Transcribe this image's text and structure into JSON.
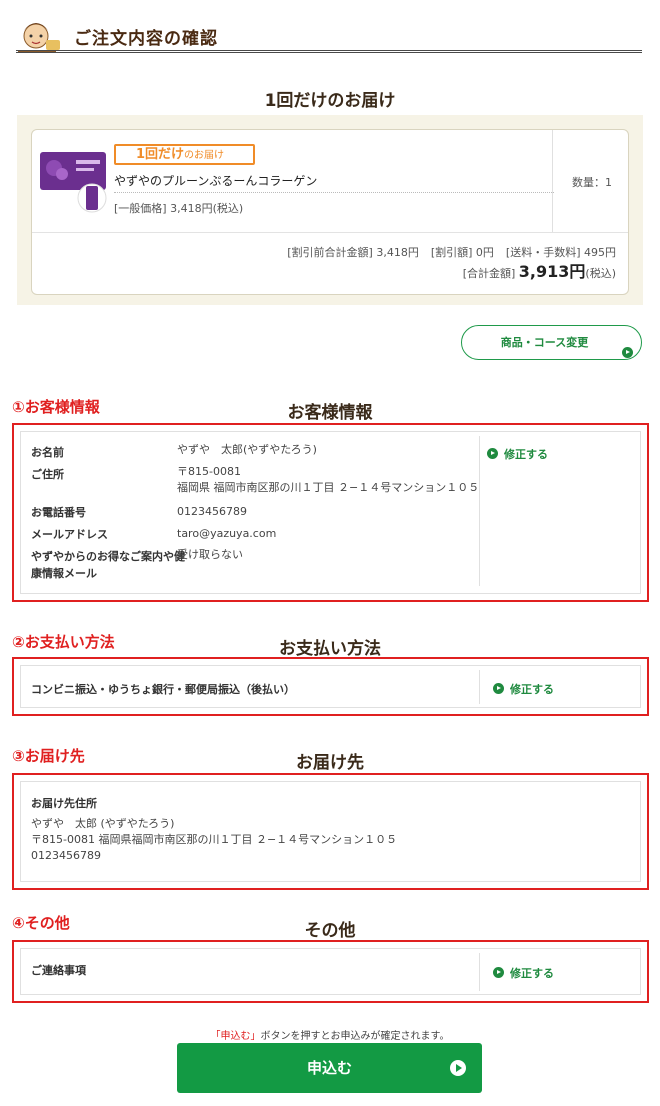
{
  "page": {
    "title": "ご注文内容の確認"
  },
  "order": {
    "heading": "1回だけのお届け",
    "badge_main": "1回だけ",
    "badge_sub": "のお届け",
    "product_name": "やずやのプルーンぷるーんコラーゲン",
    "price_line": "[一般価格] 3,418円(税込)",
    "quantity": "数量：1",
    "subtotal": "[割引前合計金額] 3,418円",
    "discount": "[割引額] 0円",
    "shipping": "[送料・手数料] 495円",
    "total_label": "[合計金額]",
    "total_value": "3,913円",
    "total_tax": "(税込)",
    "change_button": "商品・コース変更"
  },
  "customer": {
    "marker": "①お客様情報",
    "heading": "お客様情報",
    "name_label": "お名前",
    "name_value": "やずや　太郎(やずやたろう)",
    "address_label": "ご住所",
    "postal": "〒815-0081",
    "address": "福岡県 福岡市南区那の川１丁目 ２−１４号マンション１０５",
    "phone_label": "お電話番号",
    "phone_value": "0123456789",
    "email_label": "メールアドレス",
    "email_value": "taro@yazuya.com",
    "mail_label_1": "やずやからのお得なご案内や健",
    "mail_label_2": "康情報メール",
    "mail_value": "受け取らない",
    "edit": "修正する"
  },
  "payment": {
    "marker": "②お支払い方法",
    "heading": "お支払い方法",
    "method": "コンビニ振込・ゆうちょ銀行・郵便局振込（後払い）",
    "edit": "修正する"
  },
  "delivery": {
    "marker": "③お届け先",
    "heading": "お届け先",
    "label": "お届け先住所",
    "name": "やずや　太郎 (やずやたろう)",
    "address": "〒815-0081 福岡県福岡市南区那の川１丁目 ２−１４号マンション１０５",
    "phone": "0123456789"
  },
  "other": {
    "marker": "④その他",
    "heading": "その他",
    "label": "ご連絡事項",
    "edit": "修正する"
  },
  "footer": {
    "note_quote": "「申込む」",
    "note_text": "ボタンを押すとお申込みが確定されます。",
    "submit": "申込む"
  }
}
